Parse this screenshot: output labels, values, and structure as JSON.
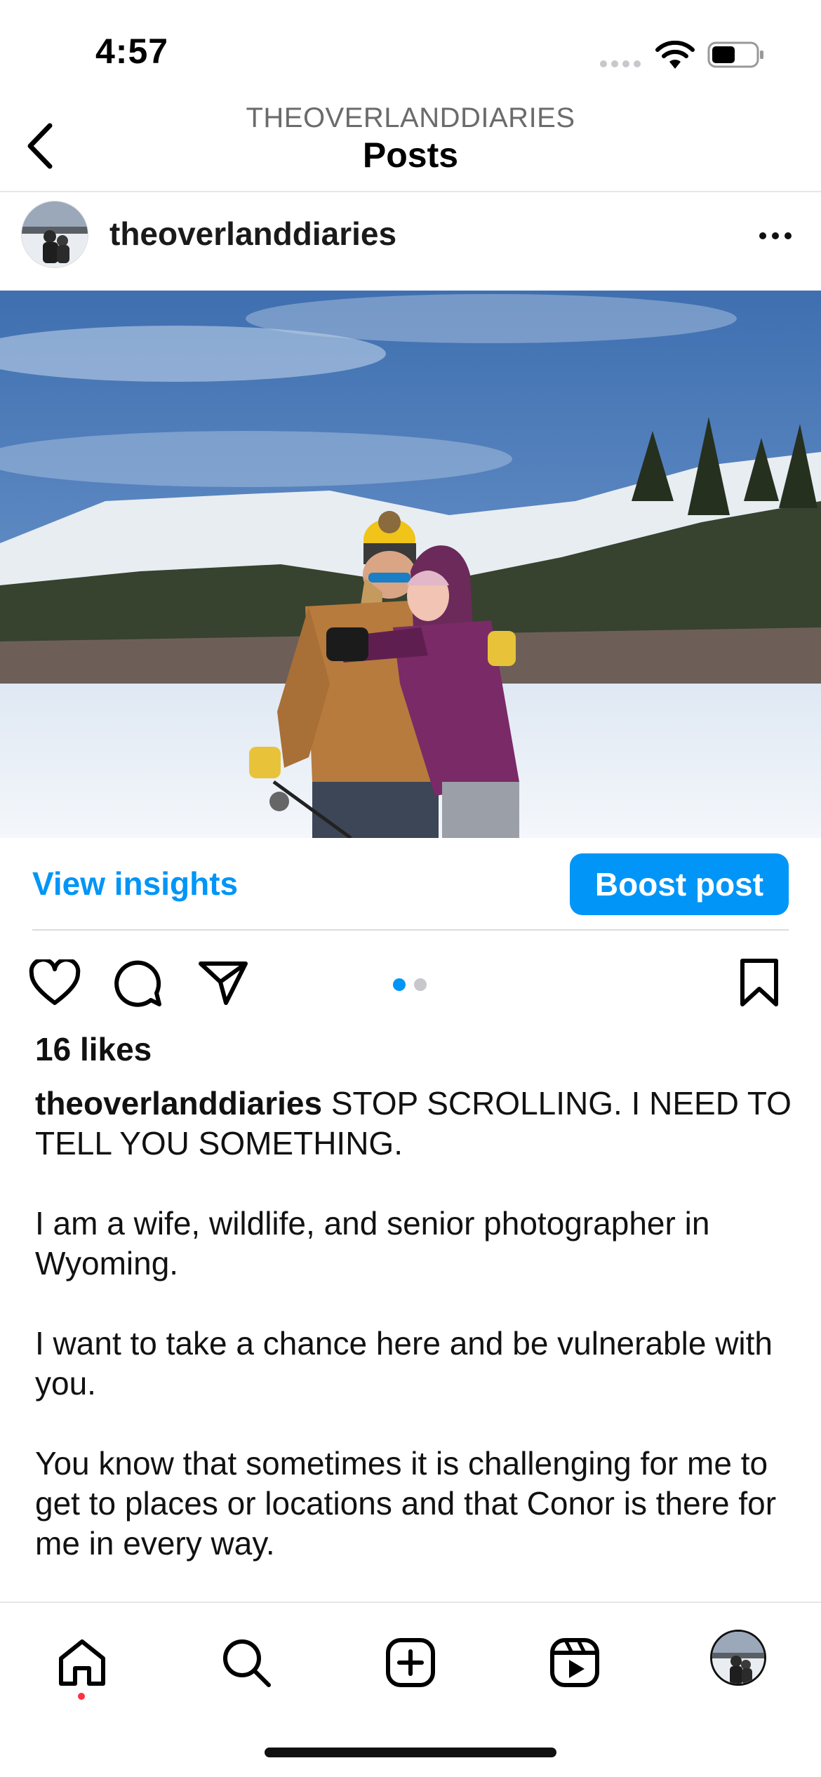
{
  "status_bar": {
    "time": "4:57"
  },
  "nav": {
    "subtitle": "THEOVERLANDDIARIES",
    "title": "Posts"
  },
  "post": {
    "username": "theoverlanddiaries",
    "insights_label": "View insights",
    "boost_label": "Boost post",
    "likes": "16 likes",
    "carousel": {
      "count": 2,
      "active": 0
    },
    "caption_user": "theoverlanddiaries",
    "caption_lines": [
      " STOP SCROLLING. I NEED TO TELL YOU SOMETHING.",
      "I am a wife, wildlife, and senior photographer in Wyoming.",
      "I want to take a chance here and be vulnerable with you.",
      "You know that sometimes it is challenging for me to get to places or locations and that Conor is there for me in every way."
    ]
  },
  "colors": {
    "accent": "#0095f6",
    "notification_dot": "#ff3040"
  },
  "icons": [
    "back-icon",
    "more-icon",
    "heart-icon",
    "comment-icon",
    "share-icon",
    "bookmark-icon",
    "home-icon",
    "search-icon",
    "create-icon",
    "reels-icon"
  ]
}
